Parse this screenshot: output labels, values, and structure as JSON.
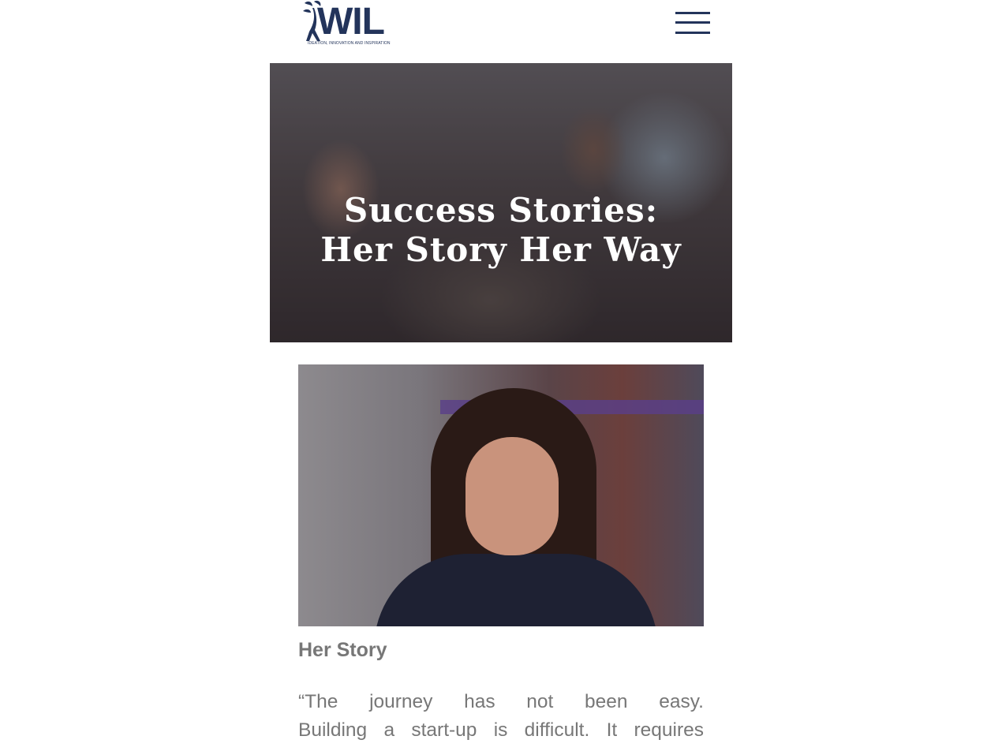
{
  "header": {
    "logo_text": "WIL",
    "logo_tagline": "IDEATION, INNOVATION AND INSPIRATION",
    "menu_icon": "hamburger-menu-icon"
  },
  "hero": {
    "title_line1": "Success Stories:",
    "title_line2": "Her Story Her Way"
  },
  "content": {
    "heading": "Her Story",
    "quote_line1": "“The journey has not been easy.",
    "quote_line2": "Building a start-up is difficult. It requires"
  },
  "colors": {
    "brand": "#23345b",
    "body_text": "#777777",
    "hero_text": "#ffffff"
  }
}
